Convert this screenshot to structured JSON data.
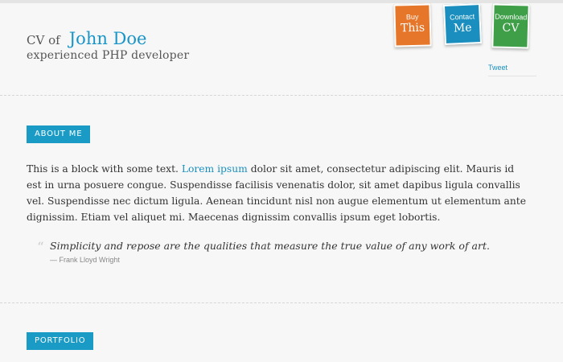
{
  "header": {
    "prefix": "CV of",
    "name": "John Doe",
    "subtitle": "experienced PHP developer"
  },
  "ribbons": {
    "buy": {
      "small": "Buy",
      "big": "This"
    },
    "contact": {
      "small": "Contact",
      "big": "Me"
    },
    "download": {
      "small": "Download",
      "big": "CV"
    }
  },
  "tweet_label": "Tweet",
  "about": {
    "label": "ABOUT ME",
    "text_before_link": "This is a block with some text. ",
    "link_text": "Lorem ipsum",
    "text_after_link": " dolor sit amet, consectetur adipiscing elit. Mauris id est in urna posuere congue. Suspendisse facilisis venenatis dolor, sit amet dapibus ligula convallis vel. Suspendisse nec dictum ligula. Aenean tincidunt nisl non augue elementum ut elementum ante dignissim. Etiam vel aliquet mi. Maecenas dignissim convallis ipsum eget lobortis.",
    "quote_mark": "“",
    "quote": "Simplicity and repose are the qualities that measure the true value of any work of art.",
    "quote_author": "— Frank Lloyd Wright"
  },
  "portfolio": {
    "label": "PORTFOLIO"
  },
  "colors": {
    "accent": "#1a95c8",
    "buy": "#e5762a",
    "contact": "#1a8fbf",
    "download": "#3f9e48"
  }
}
